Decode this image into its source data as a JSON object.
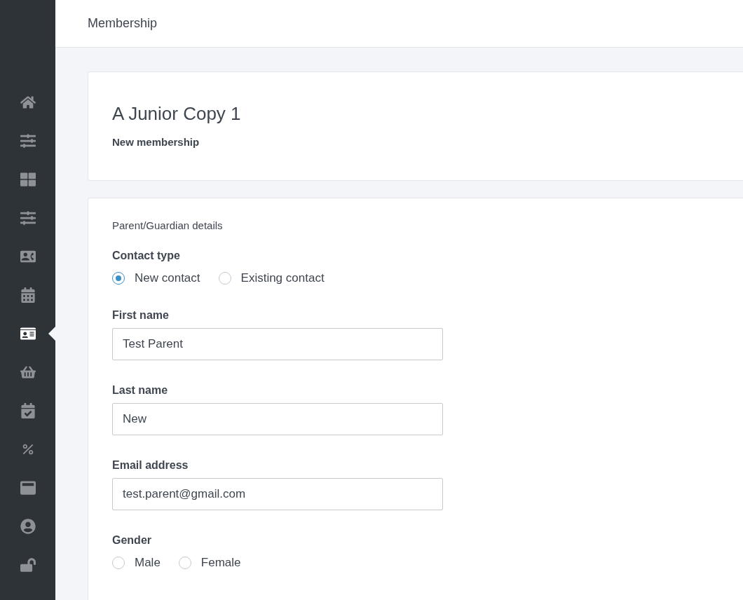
{
  "sidebar": {
    "items": [
      {
        "kind": "home",
        "selected": false
      },
      {
        "kind": "sliders",
        "selected": false
      },
      {
        "kind": "grid",
        "selected": false
      },
      {
        "kind": "sliders",
        "selected": false
      },
      {
        "kind": "contact",
        "selected": false
      },
      {
        "kind": "calendar",
        "selected": false
      },
      {
        "kind": "id-card",
        "selected": true
      },
      {
        "kind": "basket",
        "selected": false
      },
      {
        "kind": "calendar-check",
        "selected": false
      },
      {
        "kind": "percent",
        "selected": false
      },
      {
        "kind": "browser",
        "selected": false
      },
      {
        "kind": "user",
        "selected": false
      },
      {
        "kind": "unlock",
        "selected": false
      }
    ]
  },
  "header": {
    "title": "Membership"
  },
  "summary": {
    "title": "A Junior Copy 1",
    "subtitle": "New membership"
  },
  "form": {
    "section_title": "Parent/Guardian details",
    "fields": [
      {
        "kind": "radio",
        "label": "Contact type",
        "options": [
          {
            "label": "New contact",
            "selected": true
          },
          {
            "label": "Existing contact",
            "selected": false
          }
        ]
      },
      {
        "kind": "text",
        "label": "First name",
        "value": "Test Parent"
      },
      {
        "kind": "text",
        "label": "Last name",
        "value": "New"
      },
      {
        "kind": "text",
        "label": "Email address",
        "value": "test.parent@gmail.com"
      },
      {
        "kind": "radio",
        "label": "Gender",
        "options": [
          {
            "label": "Male",
            "selected": false
          },
          {
            "label": "Female",
            "selected": false
          }
        ]
      }
    ]
  }
}
